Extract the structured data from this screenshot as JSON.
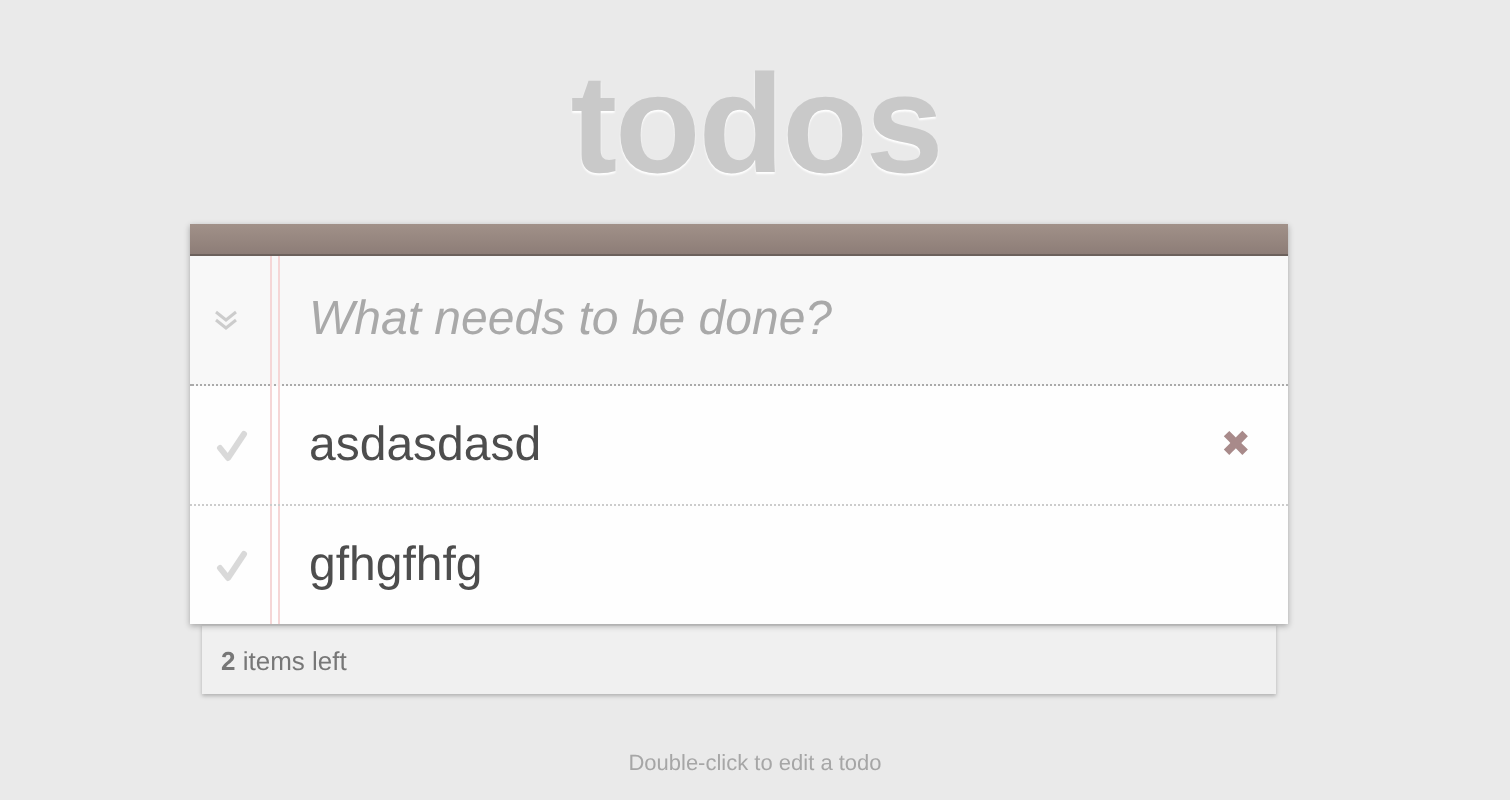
{
  "title": "todos",
  "new_todo": {
    "placeholder": "What needs to be done?"
  },
  "todos": [
    {
      "text": "asdasdasd",
      "completed": false,
      "delete": "✖"
    },
    {
      "text": "gfhgfhfg",
      "completed": false
    }
  ],
  "footer": {
    "count": "**2** items left"
  },
  "info": "Double-click to edit a todo"
}
